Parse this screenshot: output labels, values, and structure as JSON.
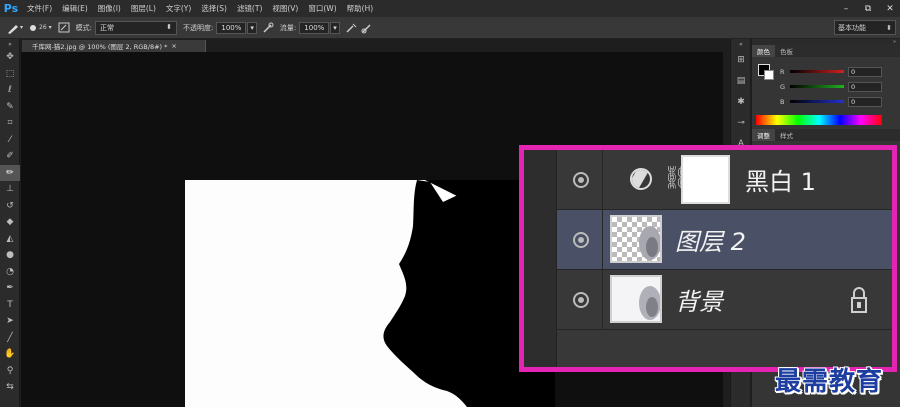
{
  "app": {
    "logo": "Ps"
  },
  "menu": {
    "items": [
      "文件(F)",
      "编辑(E)",
      "图像(I)",
      "图层(L)",
      "文字(Y)",
      "选择(S)",
      "滤镜(T)",
      "视图(V)",
      "窗口(W)",
      "帮助(H)"
    ]
  },
  "window_controls": {
    "minimize": "–",
    "restore": "⧉",
    "close": "✕"
  },
  "options": {
    "brush_size": "26",
    "mode_label": "模式:",
    "mode_value": "正常",
    "opacity_label": "不透明度:",
    "opacity_value": "100%",
    "flow_label": "流量:",
    "flow_value": "100%",
    "workspace": "基本功能"
  },
  "document": {
    "tab_title": "千库网-猫2.jpg @ 100% (图层 2, RGB/8#) *",
    "close_glyph": "×"
  },
  "panels": {
    "color_tabs": [
      "颜色",
      "色板"
    ],
    "channels": [
      {
        "label": "R",
        "value": "0",
        "color": "#d22020"
      },
      {
        "label": "G",
        "value": "0",
        "color": "#22b022"
      },
      {
        "label": "B",
        "value": "0",
        "color": "#2232d2"
      }
    ],
    "adjust_tabs": [
      "调整",
      "样式"
    ]
  },
  "layers": [
    {
      "name": "黑白 1",
      "type": "adjustment",
      "selected": false,
      "visible": true
    },
    {
      "name": "图层 2",
      "type": "image",
      "selected": true,
      "visible": true
    },
    {
      "name": "背景",
      "type": "background",
      "selected": false,
      "visible": true,
      "locked": true
    }
  ],
  "highlight_color": "#e524b4",
  "watermark": "最需教育"
}
